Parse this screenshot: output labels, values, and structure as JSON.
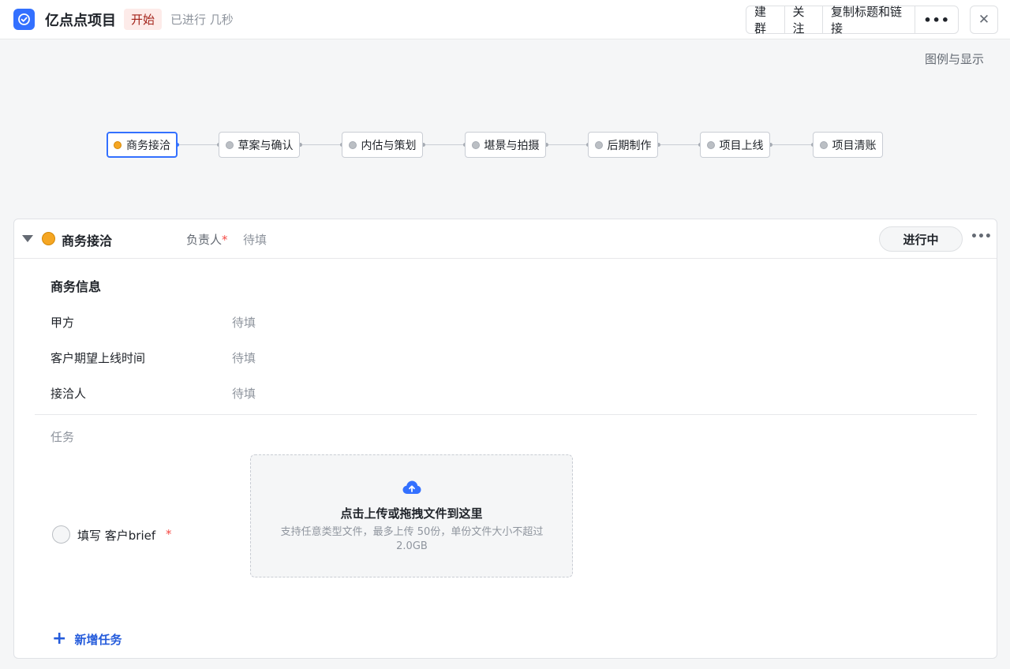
{
  "header": {
    "title": "亿点点项目",
    "status_tag": "开始",
    "elapsed": "已进行 几秒",
    "actions": [
      "建群",
      "关注",
      "复制标题和链接"
    ],
    "more": "•••",
    "close": "✕"
  },
  "legend_link": "图例与显示",
  "stages": [
    "商务接洽",
    "草案与确认",
    "内估与策划",
    "堪景与拍摄",
    "后期制作",
    "项目上线",
    "项目清账"
  ],
  "active_stage": "商务接洽",
  "card": {
    "stage_name": "商务接洽",
    "owner_label": "负责人",
    "owner_required": "*",
    "owner_value": "待填",
    "status_button": "进行中",
    "more": "•••",
    "section_title": "商务信息",
    "fields": [
      {
        "label": "甲方",
        "value": "待填"
      },
      {
        "label": "客户期望上线时间",
        "value": "待填"
      },
      {
        "label": "接洽人",
        "value": "待填"
      }
    ],
    "tasks_label": "任务",
    "task": {
      "name": "填写 客户brief",
      "required": "*"
    },
    "upload": {
      "title": "点击上传或拖拽文件到这里",
      "subtitle": "支持任意类型文件，最多上传 50份，单份文件大小不超过 2.0GB"
    },
    "add_task": "新增任务"
  },
  "colors": {
    "accent": "#3370ff",
    "stage_active": "#f5a623",
    "tag_bg": "#fdebe9",
    "tag_text": "#a3231a",
    "required": "#f54a45"
  }
}
